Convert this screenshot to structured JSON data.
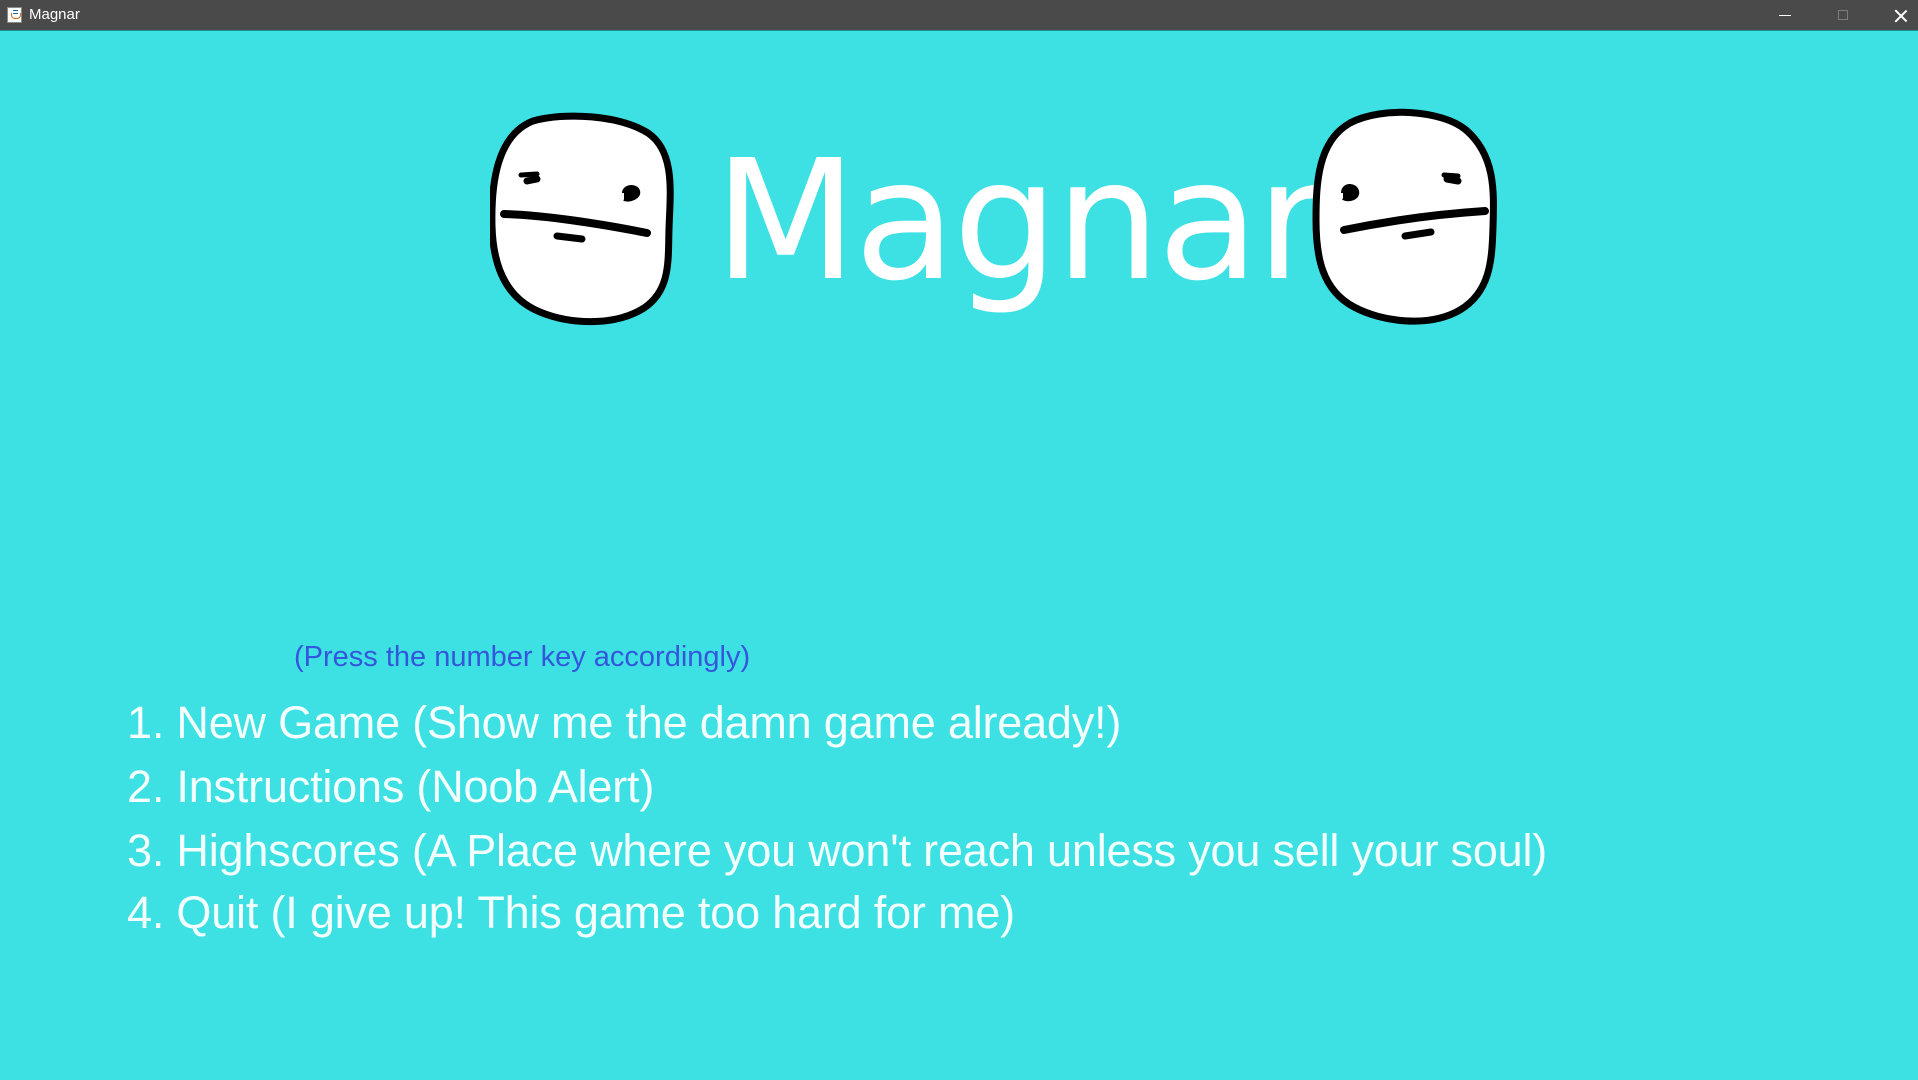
{
  "window": {
    "title": "Magnar",
    "controls": {
      "minimize": "minimize",
      "maximize": "maximize",
      "close": "close"
    }
  },
  "game": {
    "title": "Magnar",
    "background_color": "#3ee1e3",
    "title_color": "#ffffff",
    "hint_color": "#3456dd",
    "hint": "(Press the number key accordingly)",
    "menu": [
      {
        "label": "1. New Game (Show me the damn game already!)"
      },
      {
        "label": "2. Instructions (Noob Alert)"
      },
      {
        "label": "3. Highscores (A Place where you won't reach unless you sell your soul)"
      },
      {
        "label": "4. Quit (I give up! This game too hard for me)"
      }
    ],
    "icons": {
      "app": "java-app-icon",
      "left_face": "poker-face-icon",
      "right_face": "poker-face-icon"
    }
  }
}
